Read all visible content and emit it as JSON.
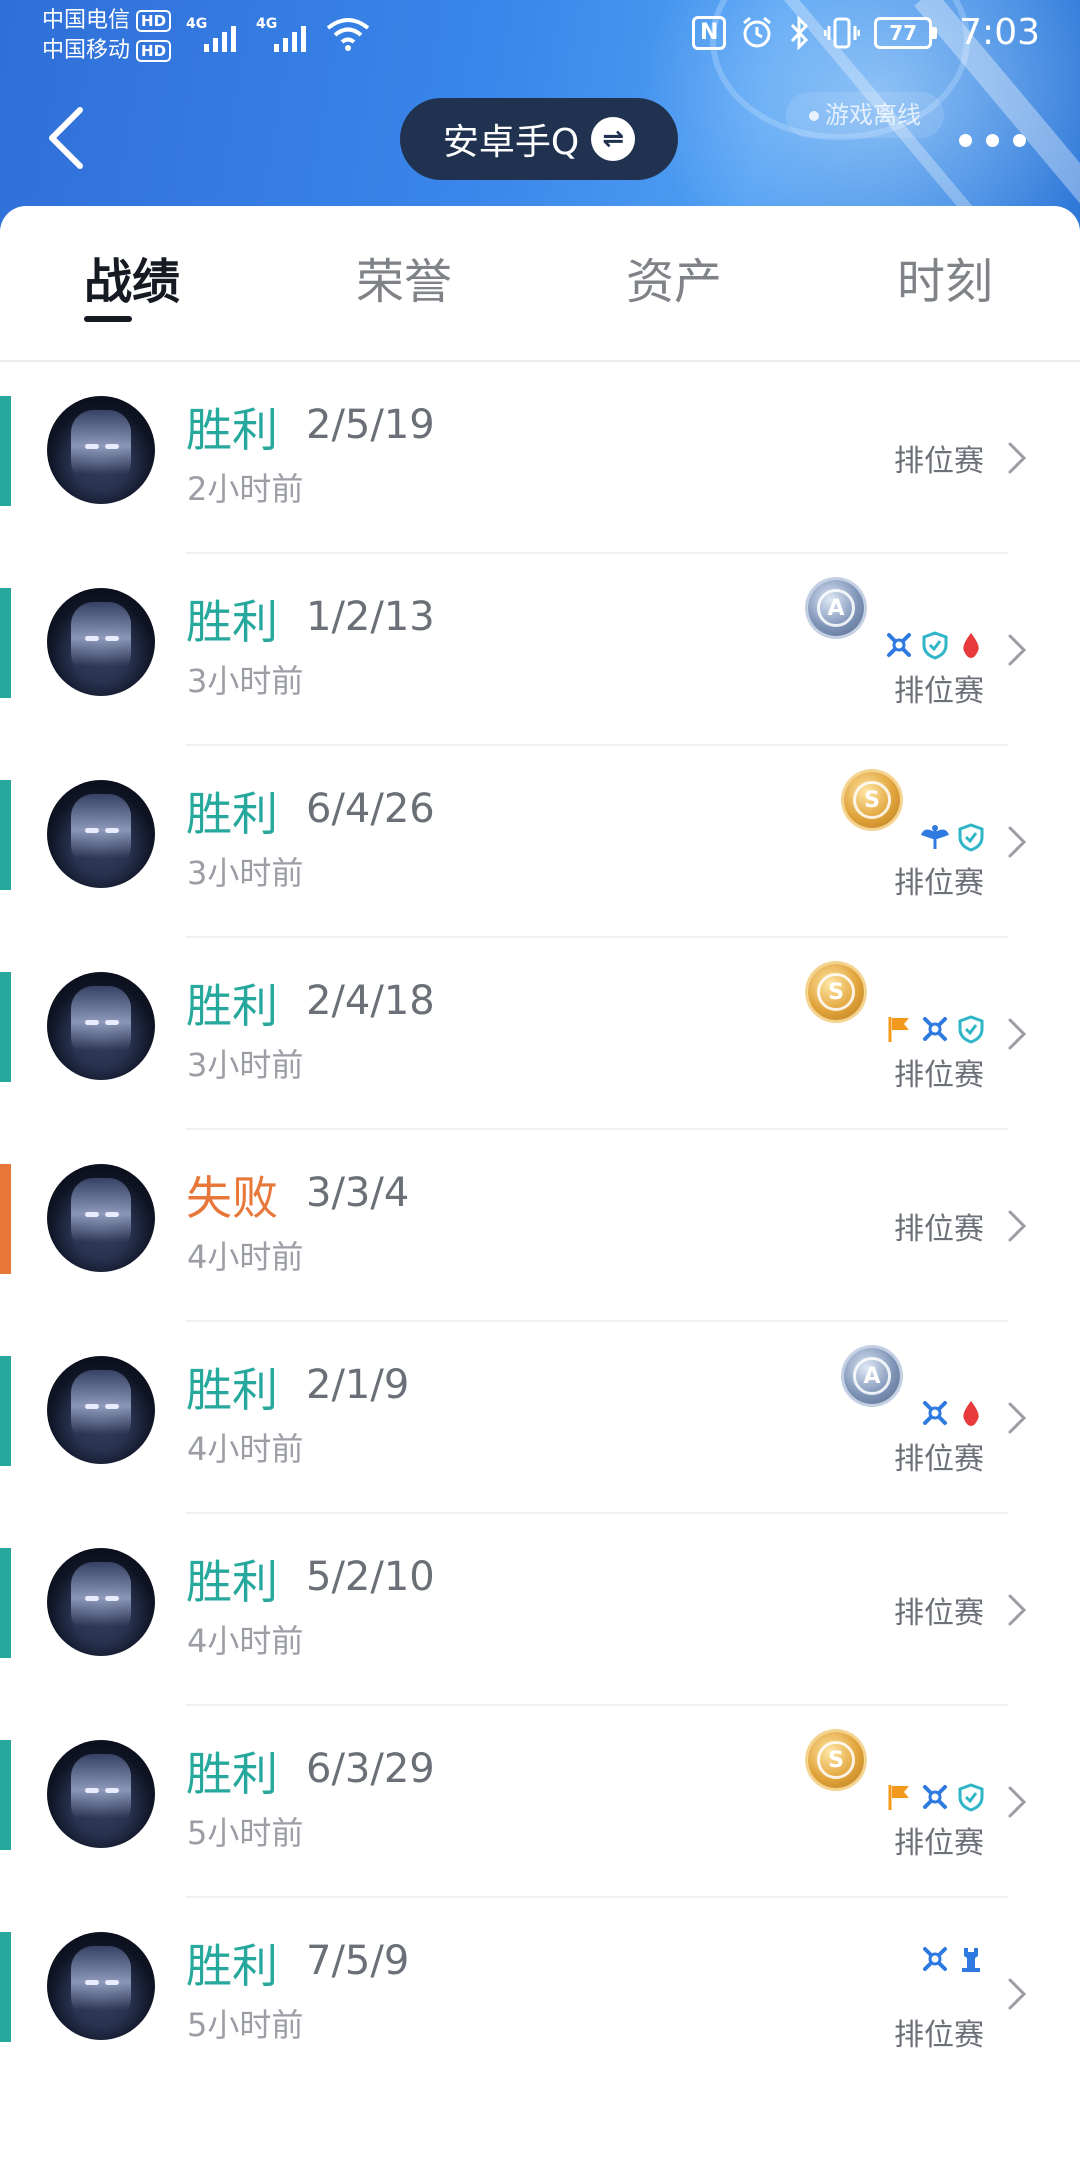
{
  "status_bar": {
    "carrier_1": "中国电信",
    "carrier_2": "中国移动",
    "hd_label": "HD",
    "network_1": "4G",
    "network_2": "4G",
    "battery": "77",
    "time": "7:03"
  },
  "header": {
    "title": "安卓手Q",
    "switch_symbol": "⇌",
    "offline_status": "游戏离线",
    "back_icon": "chevron-left-icon",
    "more_icon": "more-dots-icon"
  },
  "tabs": [
    {
      "label": "战绩",
      "active": true
    },
    {
      "label": "荣誉",
      "active": false
    },
    {
      "label": "资产",
      "active": false
    },
    {
      "label": "时刻",
      "active": false
    }
  ],
  "colors": {
    "win": "#26a89d",
    "loss": "#e8773a",
    "header_start": "#2f6fd8",
    "pill": "#20324f"
  },
  "matches": [
    {
      "result": "胜利",
      "outcome": "win",
      "kda": "2/5/19",
      "time": "2小时前",
      "mode": "排位赛",
      "medal": null,
      "badges": []
    },
    {
      "result": "胜利",
      "outcome": "win",
      "kda": "1/2/13",
      "time": "3小时前",
      "mode": "排位赛",
      "medal": {
        "type": "silver",
        "letter": "A"
      },
      "badges": [
        "swords-icon",
        "shield-icon",
        "blood-drop-icon"
      ]
    },
    {
      "result": "胜利",
      "outcome": "win",
      "kda": "6/4/26",
      "time": "3小时前",
      "mode": "排位赛",
      "medal": {
        "type": "gold",
        "letter": "S"
      },
      "badges": [
        "wings-icon",
        "shield-icon"
      ]
    },
    {
      "result": "胜利",
      "outcome": "win",
      "kda": "2/4/18",
      "time": "3小时前",
      "mode": "排位赛",
      "medal": {
        "type": "gold",
        "letter": "S"
      },
      "badges": [
        "flag-icon",
        "swords-icon",
        "shield-icon"
      ]
    },
    {
      "result": "失败",
      "outcome": "loss",
      "kda": "3/3/4",
      "time": "4小时前",
      "mode": "排位赛",
      "medal": null,
      "badges": []
    },
    {
      "result": "胜利",
      "outcome": "win",
      "kda": "2/1/9",
      "time": "4小时前",
      "mode": "排位赛",
      "medal": {
        "type": "silver",
        "letter": "A"
      },
      "badges": [
        "swords-icon",
        "blood-drop-icon"
      ]
    },
    {
      "result": "胜利",
      "outcome": "win",
      "kda": "5/2/10",
      "time": "4小时前",
      "mode": "排位赛",
      "medal": null,
      "badges": []
    },
    {
      "result": "胜利",
      "outcome": "win",
      "kda": "6/3/29",
      "time": "5小时前",
      "mode": "排位赛",
      "medal": {
        "type": "gold",
        "letter": "S"
      },
      "badges": [
        "flag-icon",
        "swords-icon",
        "shield-icon"
      ]
    },
    {
      "result": "胜利",
      "outcome": "win",
      "kda": "7/5/9",
      "time": "5小时前",
      "mode": "排位赛",
      "medal": null,
      "badges": [
        "swords-icon",
        "tower-icon"
      ]
    }
  ]
}
